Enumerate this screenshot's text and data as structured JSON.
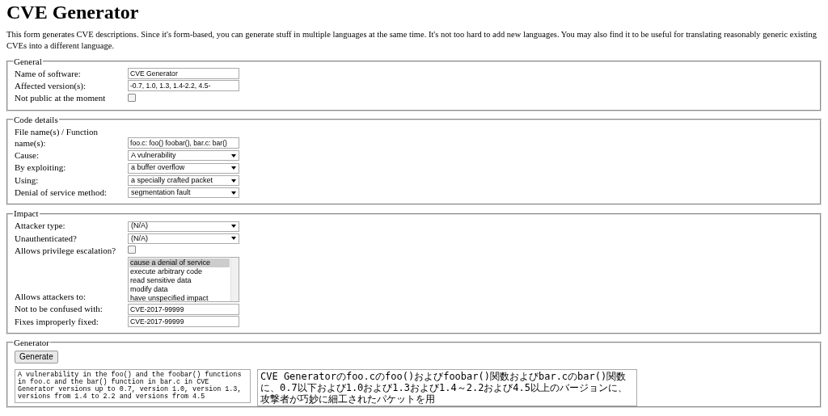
{
  "title": "CVE Generator",
  "intro": "This form generates CVE descriptions. Since it's form-based, you can generate stuff in multiple languages at the same time. It's not too hard to add new languages. You may also find it to be useful for translating reasonably generic existing CVEs into a different language.",
  "sections": [
    {
      "legend": "General",
      "fields": [
        {
          "kind": "text",
          "label": "Name of software:",
          "value": "CVE Generator"
        },
        {
          "kind": "text",
          "label": "Affected version(s):",
          "value": "-0.7, 1.0, 1.3, 1.4-2.2, 4.5-"
        },
        {
          "kind": "checkbox",
          "label": "Not public at the moment",
          "checked": false
        }
      ]
    },
    {
      "legend": "Code details",
      "fields": [
        {
          "kind": "text",
          "label": "File name(s) / Function name(s):",
          "value": "foo.c: foo() foobar(), bar.c: bar()"
        },
        {
          "kind": "select",
          "label": "Cause:",
          "value": "A vulnerability"
        },
        {
          "kind": "select",
          "label": "By exploiting:",
          "value": "a buffer overflow"
        },
        {
          "kind": "select",
          "label": "Using:",
          "value": "a specially crafted packet"
        },
        {
          "kind": "select",
          "label": "Denial of service method:",
          "value": "segmentation fault"
        }
      ]
    },
    {
      "legend": "Impact",
      "fields": [
        {
          "kind": "select",
          "label": "Attacker type:",
          "value": "(N/A)"
        },
        {
          "kind": "select",
          "label": "Unauthenticated?",
          "value": "(N/A)"
        },
        {
          "kind": "checkbox",
          "label": "Allows privilege escalation?",
          "checked": false
        },
        {
          "kind": "listbox",
          "label": "Allows attackers to:",
          "options": [
            {
              "label": "cause a denial of service",
              "selected": true
            },
            {
              "label": "execute arbitrary code",
              "selected": false
            },
            {
              "label": "read sensitive data",
              "selected": false
            },
            {
              "label": "modify data",
              "selected": false
            },
            {
              "label": "have unspecified impact",
              "selected": false
            }
          ]
        },
        {
          "kind": "text",
          "label": "Not to be confused with:",
          "value": "CVE-2017-99999"
        },
        {
          "kind": "text",
          "label": "Fixes improperly fixed:",
          "value": "CVE-2017-99999"
        }
      ]
    }
  ],
  "generator": {
    "legend": "Generator",
    "button": "Generate",
    "outputs": [
      "A vulnerability in the foo() and the foobar() functions in foo.c and the bar() function in bar.c in CVE Generator versions up to 0.7, version 1.0, version 1.3, versions from 1.4 to 2.2 and versions from 4.5",
      "CVE Generatorのfoo.cのfoo()およびfoobar()関数およびbar.cのbar()関数に、0.7以下および1.0および1.3および1.4～2.2および4.5以上のバージョンに、攻撃者が巧妙に細工されたパケットを用"
    ]
  }
}
